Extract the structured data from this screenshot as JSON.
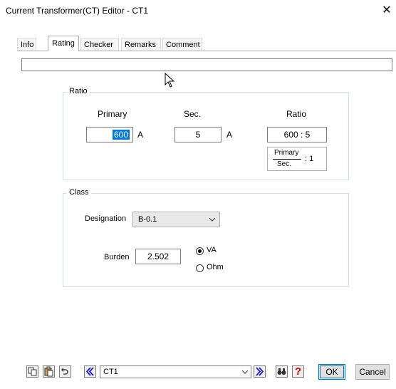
{
  "window": {
    "title": "Current Transformer(CT) Editor - CT1",
    "close": "✕"
  },
  "tabs": [
    {
      "label": "Info",
      "active": false
    },
    {
      "label": "Rating",
      "active": true
    },
    {
      "label": "Checker",
      "active": false
    },
    {
      "label": "Remarks",
      "active": false
    },
    {
      "label": "Comment",
      "active": false
    }
  ],
  "top_field": {
    "value": ""
  },
  "ratio": {
    "legend": "Ratio",
    "primary_header": "Primary",
    "sec_header": "Sec.",
    "ratio_header": "Ratio",
    "primary_value": "600",
    "primary_unit": "A",
    "sec_value": "5",
    "sec_unit": "A",
    "ratio_value": "600 : 5",
    "fraction_numerator": "Primary",
    "fraction_denominator": "Sec.",
    "fraction_suffix": ": 1"
  },
  "class": {
    "legend": "Class",
    "designation_label": "Designation",
    "designation_value": "B-0.1",
    "burden_label": "Burden",
    "burden_value": "2.502",
    "unit_options": [
      {
        "label": "VA",
        "selected": true
      },
      {
        "label": "Ohm",
        "selected": false
      }
    ]
  },
  "toolbar": {
    "icons": [
      "copy-icon",
      "paste-icon",
      "undo-icon",
      "previous-icon",
      "next-icon",
      "find-icon",
      "help-icon"
    ],
    "device_value": "CT1",
    "help_glyph": "?",
    "ok_label": "OK",
    "cancel_label": "Cancel"
  },
  "colors": {
    "accent": "#0078d7",
    "help": "#d40000",
    "nav_arrow": "#1a1ac8"
  }
}
